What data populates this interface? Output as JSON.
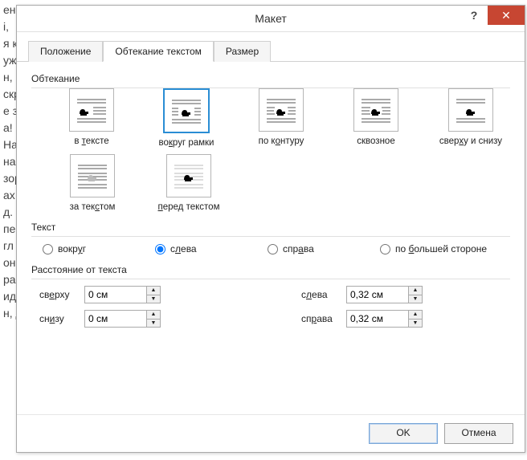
{
  "dialog": {
    "title": "Макет",
    "help_x": "?",
    "close_x": "✕",
    "tabs": {
      "position": "Положение",
      "wrapping": "Обтекание текстом",
      "size": "Размер"
    },
    "wrap_section": "Обтекание",
    "options": {
      "inline": "в тексте",
      "square": "вокруг рамки",
      "tight": "по контуру",
      "through": "сквозное",
      "topbot": "сверху и снизу",
      "behind": "за текстом",
      "front": "перед текстом"
    },
    "text_section": "Текст",
    "radios": {
      "both": "вокруг",
      "left": "слева",
      "right": "справа",
      "largest": "по большей стороне"
    },
    "dist_section": "Расстояние от текста",
    "dist": {
      "top_l": "сверху",
      "top_v": "0 см",
      "bot_l": "снизу",
      "bot_v": "0 см",
      "left_l": "слева",
      "left_v": "0,32 см",
      "right_l": "справа",
      "right_v": "0,32 см"
    },
    "ok": "OK",
    "cancel": "Отмена"
  },
  "bg": "ен,\nі,\nя к\nуж\nн, -\nскр\nе за\nа!\nНа\nнав\nзор\nах\nд.\nпе\nгл\nон\nра\nид\nн, д"
}
